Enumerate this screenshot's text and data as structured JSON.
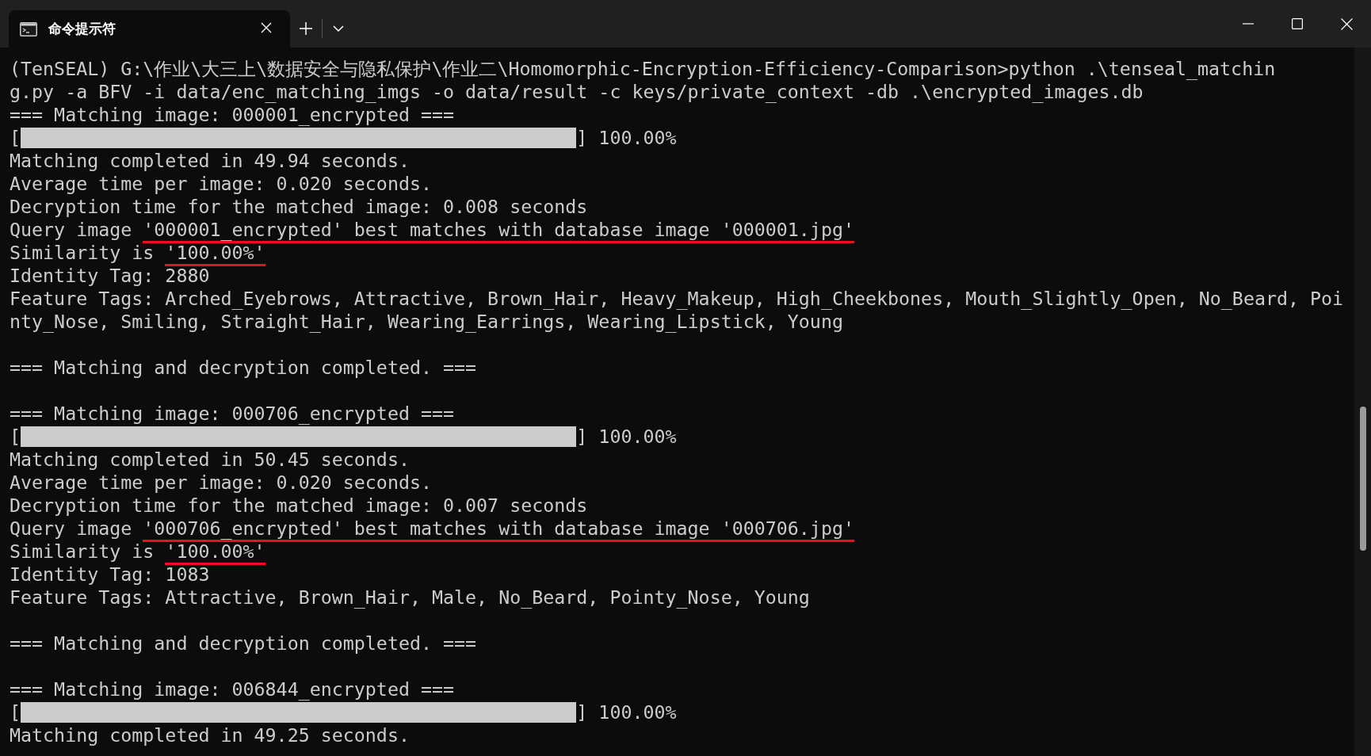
{
  "window": {
    "tabs": [
      {
        "title": "命令提示符",
        "selected": true
      }
    ]
  },
  "terminal": {
    "lines": [
      {
        "kind": "text",
        "text": "(TenSEAL) G:\\作业\\大三上\\数据安全与隐私保护\\作业二\\Homomorphic-Encryption-Efficiency-Comparison>python .\\tenseal_matchin"
      },
      {
        "kind": "text",
        "text": "g.py -a BFV -i data/enc_matching_imgs -o data/result -c keys/private_context -db .\\encrypted_images.db"
      },
      {
        "kind": "text",
        "text": "=== Matching image: 000001_encrypted ==="
      },
      {
        "kind": "progress",
        "open": "[",
        "level": 1,
        "close": "] 100.00%"
      },
      {
        "kind": "text",
        "text": "Matching completed in 49.94 seconds."
      },
      {
        "kind": "text",
        "text": "Average time per image: 0.020 seconds."
      },
      {
        "kind": "text",
        "text": "Decryption time for the matched image: 0.008 seconds"
      },
      {
        "kind": "marked",
        "lead": "Query image ",
        "marked": "'000001_encrypted' best matches with database image '000001.jpg'"
      },
      {
        "kind": "marked",
        "lead": "Similarity is ",
        "marked": "'100.00%'"
      },
      {
        "kind": "text",
        "text": "Identity Tag: 2880"
      },
      {
        "kind": "text",
        "text": "Feature Tags: Arched_Eyebrows, Attractive, Brown_Hair, Heavy_Makeup, High_Cheekbones, Mouth_Slightly_Open, No_Beard, Poi"
      },
      {
        "kind": "text",
        "text": "nty_Nose, Smiling, Straight_Hair, Wearing_Earrings, Wearing_Lipstick, Young"
      },
      {
        "kind": "blank"
      },
      {
        "kind": "text",
        "text": "=== Matching and decryption completed. ==="
      },
      {
        "kind": "blank"
      },
      {
        "kind": "text",
        "text": "=== Matching image: 000706_encrypted ==="
      },
      {
        "kind": "progress",
        "open": "[",
        "level": 1,
        "close": "] 100.00%"
      },
      {
        "kind": "text",
        "text": "Matching completed in 50.45 seconds."
      },
      {
        "kind": "text",
        "text": "Average time per image: 0.020 seconds."
      },
      {
        "kind": "text",
        "text": "Decryption time for the matched image: 0.007 seconds"
      },
      {
        "kind": "marked",
        "lead": "Query image ",
        "marked": "'000706_encrypted' best matches with database image '000706.jpg'"
      },
      {
        "kind": "marked",
        "lead": "Similarity is ",
        "marked": "'100.00%'"
      },
      {
        "kind": "text",
        "text": "Identity Tag: 1083"
      },
      {
        "kind": "text",
        "text": "Feature Tags: Attractive, Brown_Hair, Male, No_Beard, Pointy_Nose, Young"
      },
      {
        "kind": "blank"
      },
      {
        "kind": "text",
        "text": "=== Matching and decryption completed. ==="
      },
      {
        "kind": "blank"
      },
      {
        "kind": "text",
        "text": "=== Matching image: 006844_encrypted ==="
      },
      {
        "kind": "progress",
        "open": "[",
        "level": 1,
        "close": "] 100.00%"
      },
      {
        "kind": "text",
        "text": "Matching completed in 49.25 seconds."
      }
    ]
  }
}
